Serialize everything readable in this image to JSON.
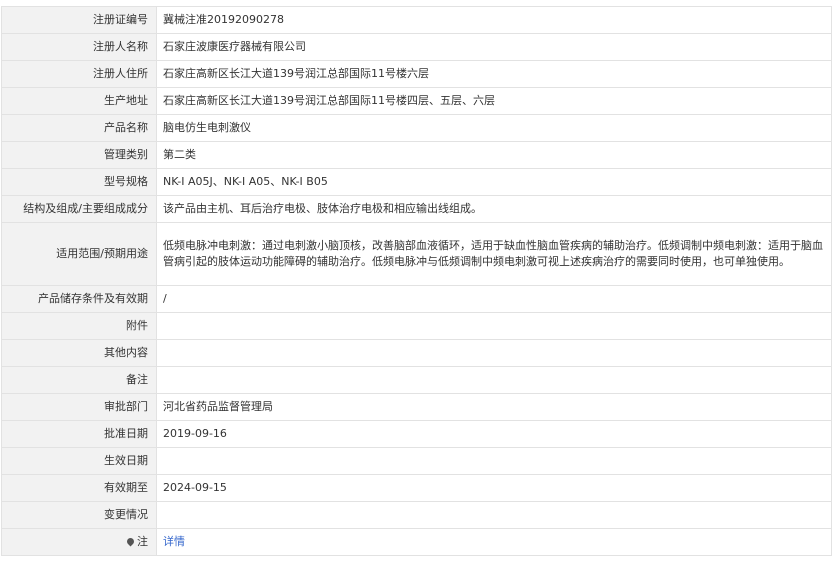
{
  "rows": [
    {
      "label": "注册证编号",
      "value": "冀械注准20192090278"
    },
    {
      "label": "注册人名称",
      "value": "石家庄波康医疗器械有限公司"
    },
    {
      "label": "注册人住所",
      "value": "石家庄高新区长江大道139号润江总部国际11号楼六层"
    },
    {
      "label": "生产地址",
      "value": "石家庄高新区长江大道139号润江总部国际11号楼四层、五层、六层"
    },
    {
      "label": "产品名称",
      "value": "脑电仿生电刺激仪"
    },
    {
      "label": "管理类别",
      "value": "第二类"
    },
    {
      "label": "型号规格",
      "value": "NK-I A05J、NK-I A05、NK-I B05"
    },
    {
      "label": "结构及组成/主要组成成分",
      "value": "该产品由主机、耳后治疗电极、肢体治疗电极和相应输出线组成。"
    },
    {
      "label": "适用范围/预期用途",
      "value": "低频电脉冲电刺激：通过电刺激小脑顶核，改善脑部血液循环，适用于缺血性脑血管疾病的辅助治疗。低频调制中频电刺激：适用于脑血管病引起的肢体运动功能障碍的辅助治疗。低频电脉冲与低频调制中频电刺激可视上述疾病治疗的需要同时使用，也可单独使用。"
    },
    {
      "label": "产品储存条件及有效期",
      "value": "/"
    },
    {
      "label": "附件",
      "value": ""
    },
    {
      "label": "其他内容",
      "value": ""
    },
    {
      "label": "备注",
      "value": ""
    },
    {
      "label": "审批部门",
      "value": "河北省药品监督管理局"
    },
    {
      "label": "批准日期",
      "value": "2019-09-16"
    },
    {
      "label": "生效日期",
      "value": ""
    },
    {
      "label": "有效期至",
      "value": "2024-09-15"
    },
    {
      "label": "变更情况",
      "value": ""
    }
  ],
  "note_row": {
    "label": "注",
    "link_text": "详情",
    "icon": "pin-icon"
  }
}
